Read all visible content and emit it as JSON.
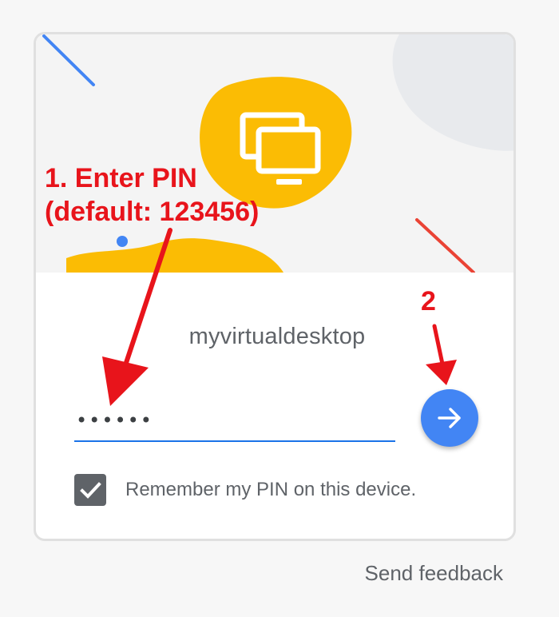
{
  "card": {
    "hostname": "myvirtualdesktop",
    "pin_field": {
      "value": "••••••",
      "placeholder": "",
      "accent_color": "#1a73e8"
    },
    "go_button": {
      "icon": "arrow-right-icon",
      "color": "#4285f4"
    },
    "remember": {
      "checked": true,
      "label": "Remember my PIN on this device."
    },
    "hero": {
      "icon": "remote-desktop-screens-icon",
      "accent_color": "#fbbc04"
    }
  },
  "footer": {
    "feedback_label": "Send feedback"
  },
  "annotations": {
    "step1_line1": "1. Enter PIN",
    "step1_line2": "(default: 123456)",
    "step2": "2",
    "color": "#e8141b"
  }
}
